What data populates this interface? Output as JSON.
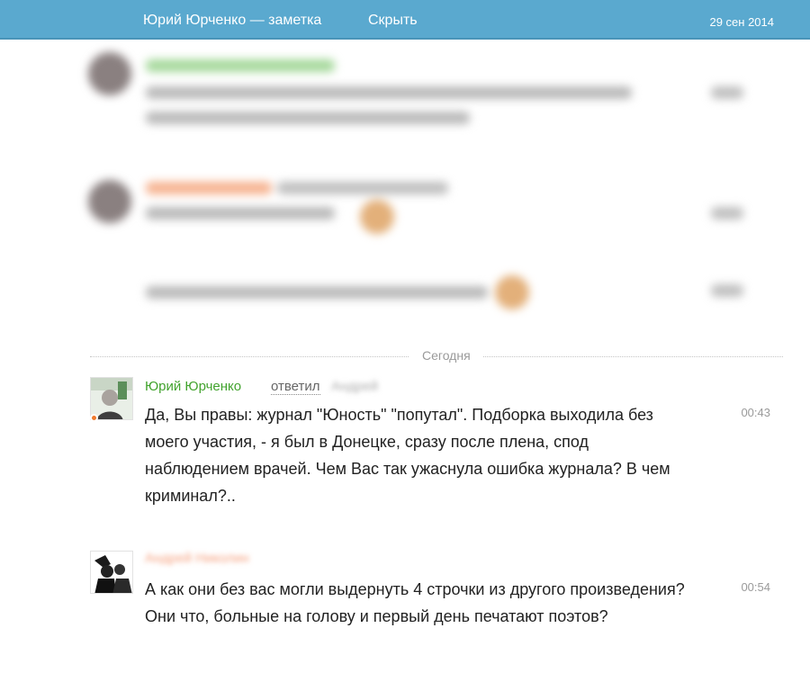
{
  "topbar": {
    "title": "Юрий Юрченко — заметка",
    "hide_label": "Скрыть",
    "date": "29 сен 2014"
  },
  "divider": {
    "label": "Сегодня"
  },
  "messages": [
    {
      "author": "Юрий Юрченко",
      "replied_label": "ответил",
      "reply_to": "Андрей",
      "text": "Да, Вы правы: журнал \"Юность\" \"попутал\". Подборка выходила без моего участия, - я был в Донецке, сразу после плена, спод наблюдением врачей. Чем Вас так ужаснула ошибка журнала? В чем криминал?..",
      "time": "00:43"
    },
    {
      "author": "Андрей Николин",
      "text": "А как они без вас могли выдернуть 4 строчки из другого произведения? Они что, больные на голову и первый день печатают поэтов?",
      "time": "00:54"
    }
  ]
}
